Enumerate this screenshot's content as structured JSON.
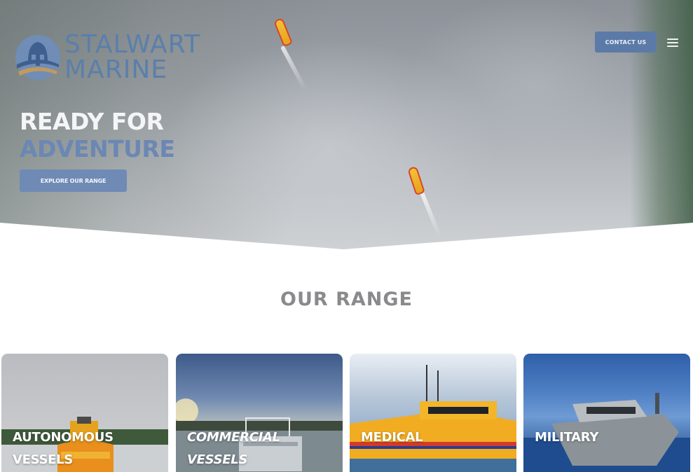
{
  "brand": {
    "name_line1": "STALWART",
    "name_line2": "MARINE",
    "colors": {
      "primary": "#5c7aa8",
      "accent": "#6b87b4"
    }
  },
  "header": {
    "contact_label": "CONTACT US",
    "menu_icon": "hamburger-menu-icon"
  },
  "hero": {
    "headline_line1": "READY FOR",
    "headline_line2": "ADVENTURE",
    "cta_label": "EXPLORE OUR RANGE"
  },
  "range": {
    "title": "OUR RANGE",
    "cards": [
      {
        "line1": "AUTONOMOUS",
        "line2": "VESSELS"
      },
      {
        "line1": "COMMERCIAL",
        "line2": "VESSELS"
      },
      {
        "line1": "MEDICAL",
        "line2": ""
      },
      {
        "line1": "MILITARY",
        "line2": ""
      }
    ]
  }
}
